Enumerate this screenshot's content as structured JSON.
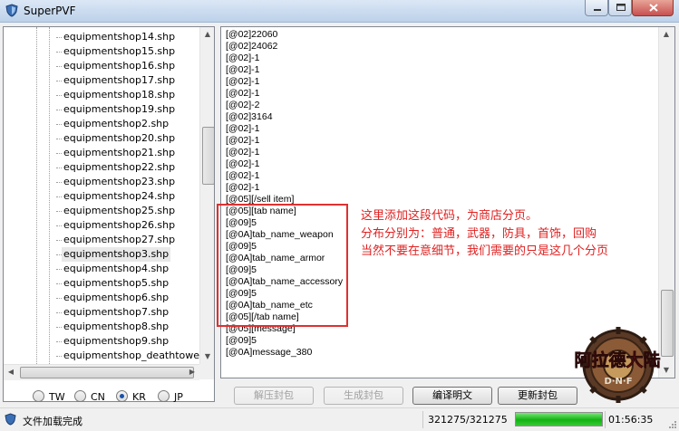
{
  "window": {
    "title": "SuperPVF"
  },
  "tree": {
    "items": [
      "equipmentshop14.shp",
      "equipmentshop15.shp",
      "equipmentshop16.shp",
      "equipmentshop17.shp",
      "equipmentshop18.shp",
      "equipmentshop19.shp",
      "equipmentshop2.shp",
      "equipmentshop20.shp",
      "equipmentshop21.shp",
      "equipmentshop22.shp",
      "equipmentshop23.shp",
      "equipmentshop24.shp",
      "equipmentshop25.shp",
      "equipmentshop26.shp",
      "equipmentshop27.shp",
      "equipmentshop3.shp",
      "equipmentshop4.shp",
      "equipmentshop5.shp",
      "equipmentshop6.shp",
      "equipmentshop7.shp",
      "equipmentshop8.shp",
      "equipmentshop9.shp",
      "equipmentshop_deathtower.sh"
    ],
    "selected": "equipmentshop3.shp"
  },
  "regions": {
    "tw": "TW",
    "cn": "CN",
    "kr": "KR",
    "jp": "JP",
    "selected": "KR"
  },
  "editor": {
    "lines": [
      "[@02]22060",
      "[@02]24062",
      "[@02]-1",
      "[@02]-1",
      "[@02]-1",
      "[@02]-1",
      "[@02]-2",
      "[@02]3164",
      "[@02]-1",
      "[@02]-1",
      "[@02]-1",
      "[@02]-1",
      "[@02]-1",
      "[@02]-1",
      "[@05][/sell item]",
      "[@05][tab name]",
      "[@09]5",
      "[@0A]tab_name_weapon",
      "[@09]5",
      "[@0A]tab_name_armor",
      "[@09]5",
      "[@0A]tab_name_accessory",
      "[@09]5",
      "[@0A]tab_name_etc",
      "[@05][/tab name]",
      "[@05][message]",
      "[@09]5",
      "[@0A]message_380"
    ]
  },
  "annotation": {
    "lines": [
      "这里添加这段代码，为商店分页。",
      "分布分别为：普通，武器，防具，首饰，回购",
      "当然不要在意细节，我们需要的只是这几个分页"
    ],
    "color": "#e02020"
  },
  "buttons": {
    "unpack": "解压封包",
    "build": "生成封包",
    "compile": "编译明文",
    "update": "更新封包"
  },
  "logo": {
    "text": "阿拉德大陆",
    "sub": "D·N·F"
  },
  "status": {
    "message": "文件加载完成",
    "progress_text": "321275/321275",
    "progress": 1.0,
    "time": "01:56:35"
  },
  "icons": {
    "app": "shield-icon",
    "status": "shield-icon"
  }
}
